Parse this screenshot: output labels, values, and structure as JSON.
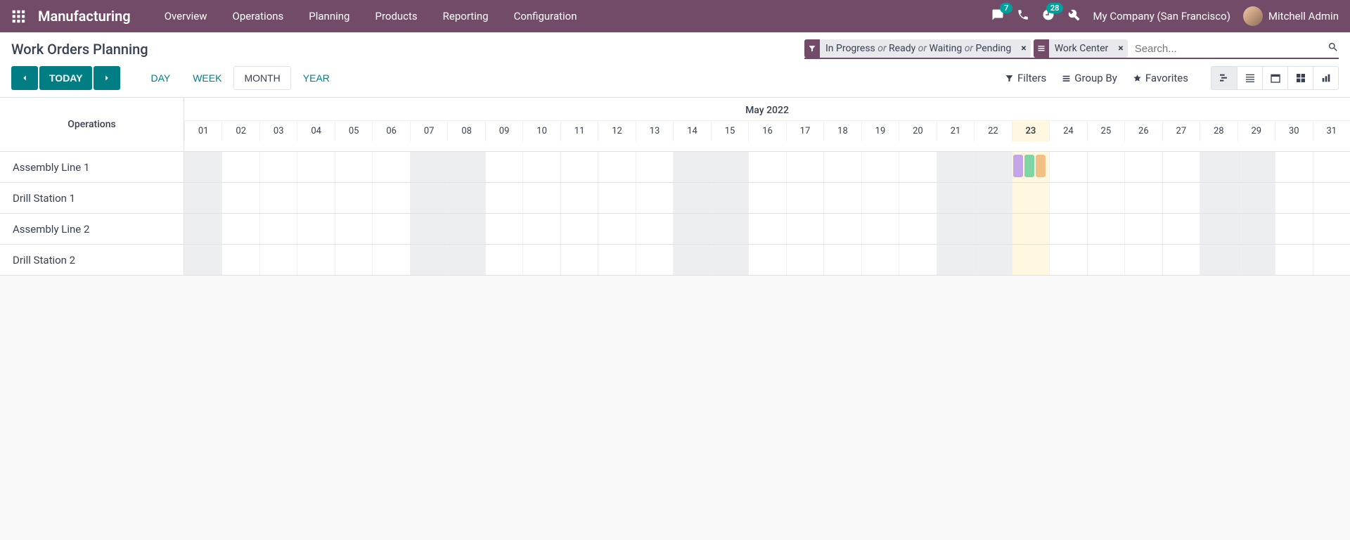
{
  "topbar": {
    "app_name": "Manufacturing",
    "menu": [
      "Overview",
      "Operations",
      "Planning",
      "Products",
      "Reporting",
      "Configuration"
    ],
    "messages_badge": "7",
    "activities_badge": "28",
    "company": "My Company (San Francisco)",
    "user": "Mitchell Admin"
  },
  "breadcrumb": "Work Orders Planning",
  "search": {
    "filter_facet_parts": [
      "In Progress",
      "Ready",
      "Waiting",
      "Pending"
    ],
    "sep": " or ",
    "group_facet": "Work Center",
    "placeholder": "Search..."
  },
  "nav": {
    "today": "TODAY",
    "scales": [
      "DAY",
      "WEEK",
      "MONTH",
      "YEAR"
    ],
    "active_scale": "MONTH"
  },
  "search_options": {
    "filters": "Filters",
    "group_by": "Group By",
    "favorites": "Favorites"
  },
  "gantt": {
    "side_header": "Operations",
    "month_label": "May 2022",
    "days": [
      "01",
      "02",
      "03",
      "04",
      "05",
      "06",
      "07",
      "08",
      "09",
      "10",
      "11",
      "12",
      "13",
      "14",
      "15",
      "16",
      "17",
      "18",
      "19",
      "20",
      "21",
      "22",
      "23",
      "24",
      "25",
      "26",
      "27",
      "28",
      "29",
      "30",
      "31"
    ],
    "today": "23",
    "weekend_days": [
      "01",
      "07",
      "08",
      "14",
      "15",
      "21",
      "22",
      "28",
      "29"
    ],
    "rows": [
      "Assembly Line 1",
      "Drill Station 1",
      "Assembly Line 2",
      "Drill Station 2"
    ],
    "pills": [
      {
        "row": 0,
        "day": "23",
        "offset": 0,
        "color": "#c3a5e8"
      },
      {
        "row": 0,
        "day": "23",
        "offset": 1,
        "color": "#7fd6a4"
      },
      {
        "row": 0,
        "day": "23",
        "offset": 2,
        "color": "#f2c085"
      }
    ]
  }
}
